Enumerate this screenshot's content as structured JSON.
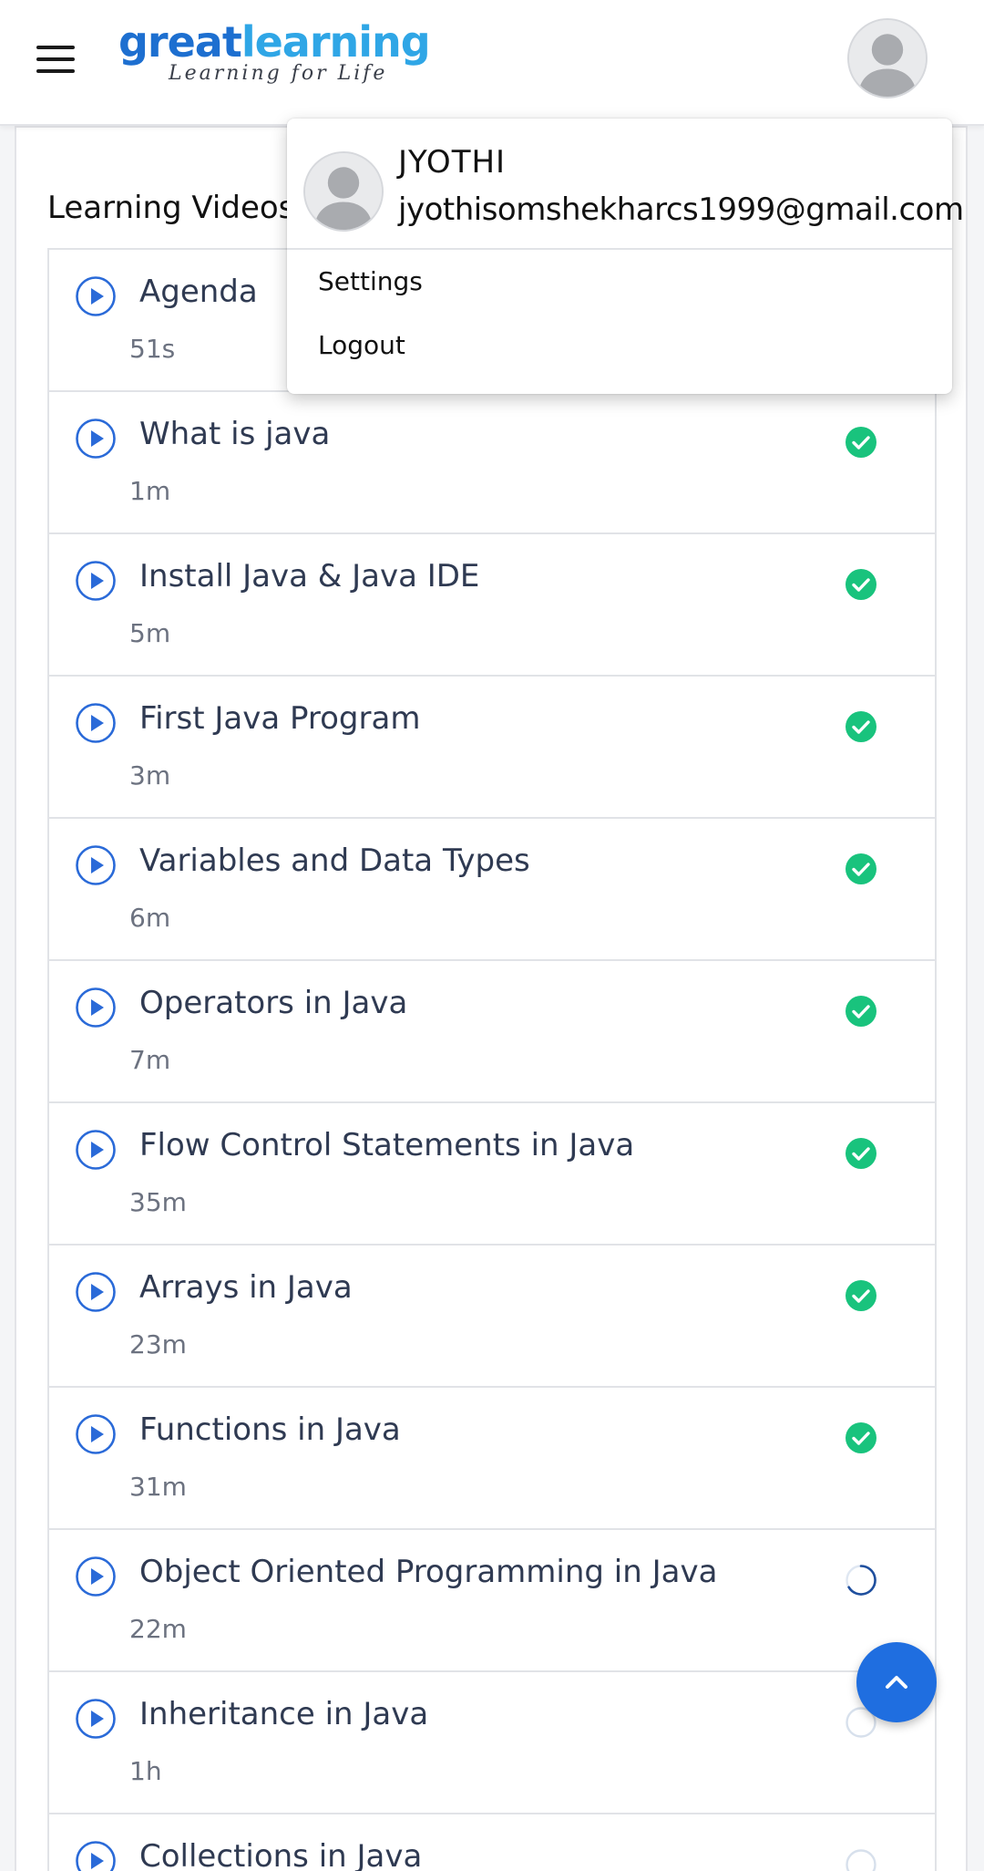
{
  "header": {
    "logo_great": "great",
    "logo_learning": "learning",
    "logo_tagline": "Learning for Life",
    "menu_icon": "hamburger-menu-icon",
    "avatar_icon": "user-avatar-icon"
  },
  "section": {
    "title": "Learning Videos"
  },
  "colors": {
    "brand_blue": "#1d6fd0",
    "brand_light_blue": "#2fa6e6",
    "completed_green": "#19c37d",
    "play_blue": "#2a6ad8",
    "fab_blue": "#1f6ee0"
  },
  "videos": [
    {
      "title": "Agenda",
      "duration": "51s",
      "status": "completed"
    },
    {
      "title": "What is java",
      "duration": "1m",
      "status": "completed"
    },
    {
      "title": "Install Java & Java IDE",
      "duration": "5m",
      "status": "completed"
    },
    {
      "title": "First Java Program",
      "duration": "3m",
      "status": "completed"
    },
    {
      "title": "Variables and Data Types",
      "duration": "6m",
      "status": "completed"
    },
    {
      "title": "Operators in Java",
      "duration": "7m",
      "status": "completed"
    },
    {
      "title": "Flow Control Statements in Java",
      "duration": "35m",
      "status": "completed"
    },
    {
      "title": "Arrays in Java",
      "duration": "23m",
      "status": "completed"
    },
    {
      "title": "Functions in Java",
      "duration": "31m",
      "status": "completed"
    },
    {
      "title": "Object Oriented Programming in Java",
      "duration": "22m",
      "status": "in-progress"
    },
    {
      "title": "Inheritance in Java",
      "duration": "1h",
      "status": "not-started"
    },
    {
      "title": "Collections in Java",
      "duration": "",
      "status": "not-started"
    }
  ],
  "dropdown": {
    "name": "JYOTHI",
    "email": "jyothisomshekharcs1999@gmail.com",
    "settings_label": "Settings",
    "logout_label": "Logout"
  },
  "fab": {
    "icon": "chevron-up-icon"
  }
}
